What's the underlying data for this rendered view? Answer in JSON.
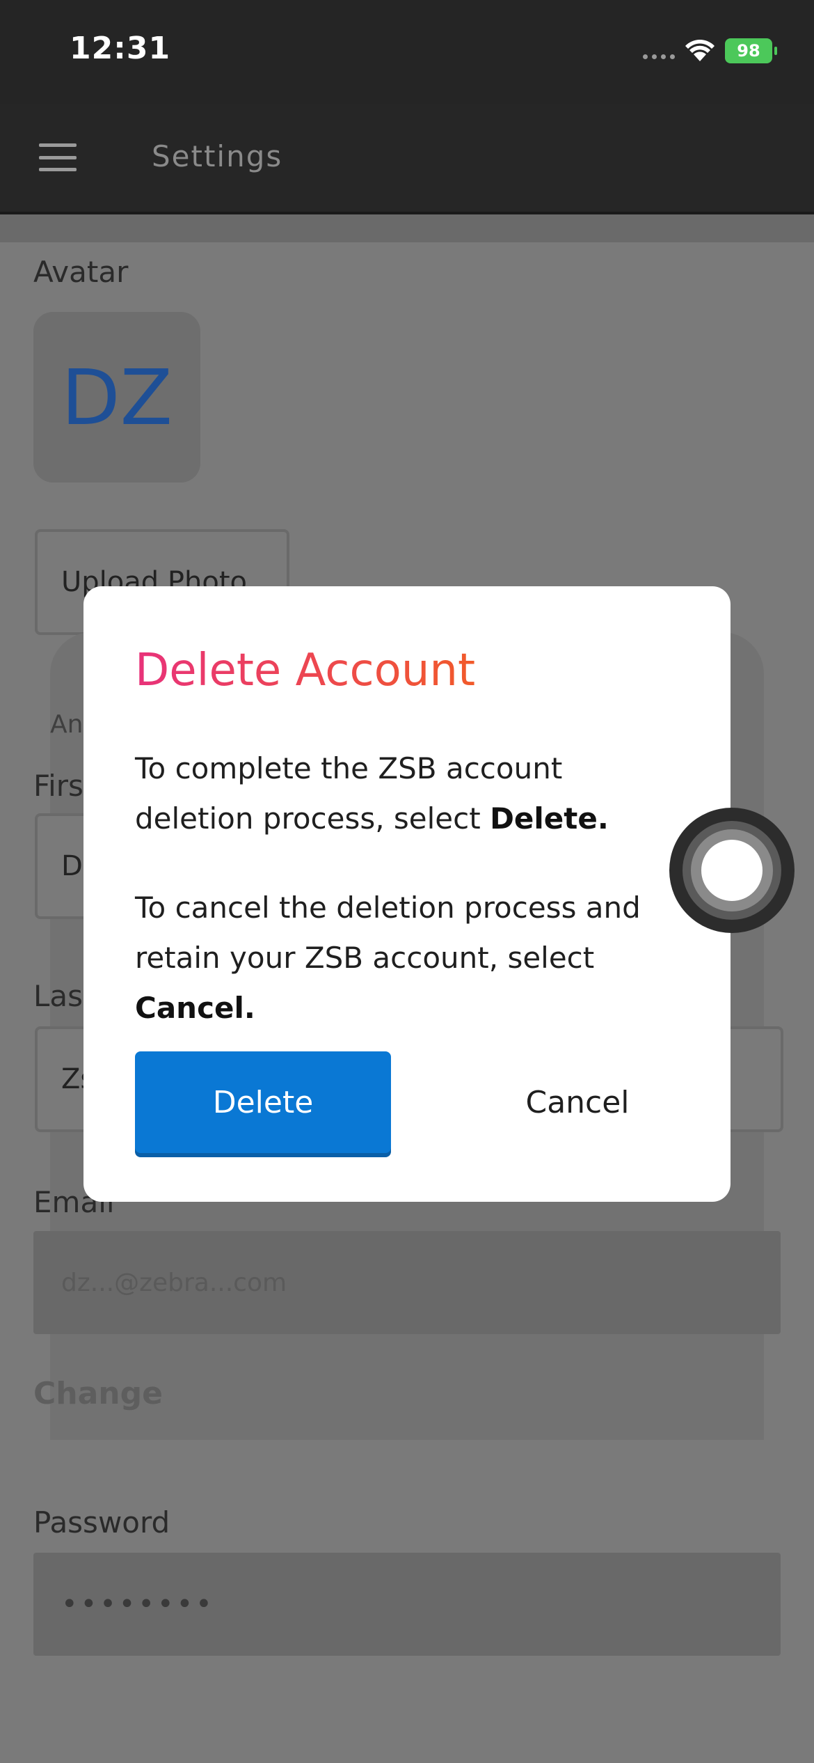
{
  "status_bar": {
    "time": "12:31",
    "battery": "98",
    "icons": [
      "cellular-signal-icon",
      "wifi-icon",
      "battery-charging-icon"
    ]
  },
  "app_bar": {
    "title": "Settings",
    "menu_icon": "hamburger-menu-icon"
  },
  "profile": {
    "avatar_label": "Avatar",
    "avatar_initials": "DZ",
    "upload_button": "Upload Photo",
    "partial_text": "An",
    "first_name_label": "Firs",
    "first_name_value": "D",
    "last_name_label": "Las",
    "last_name_value": "Zs",
    "email_label": "Email",
    "email_value": "dz...@zebra...com",
    "change_link": "Change",
    "password_label": "Password",
    "password_value": "••••••••"
  },
  "dialog": {
    "title": "Delete Account",
    "paragraph1_text": "To complete the ZSB account deletion process, select ",
    "paragraph1_bold": "Delete.",
    "paragraph2_text": "To cancel the deletion process and retain your ZSB account, select ",
    "paragraph2_bold": "Cancel.",
    "delete_label": "Delete",
    "cancel_label": "Cancel"
  },
  "colors": {
    "accent_blue": "#0a78d4",
    "title_gradient_start": "#e8327a",
    "title_gradient_end": "#f15a2a",
    "overlay_gray": "#7a7a7a"
  }
}
